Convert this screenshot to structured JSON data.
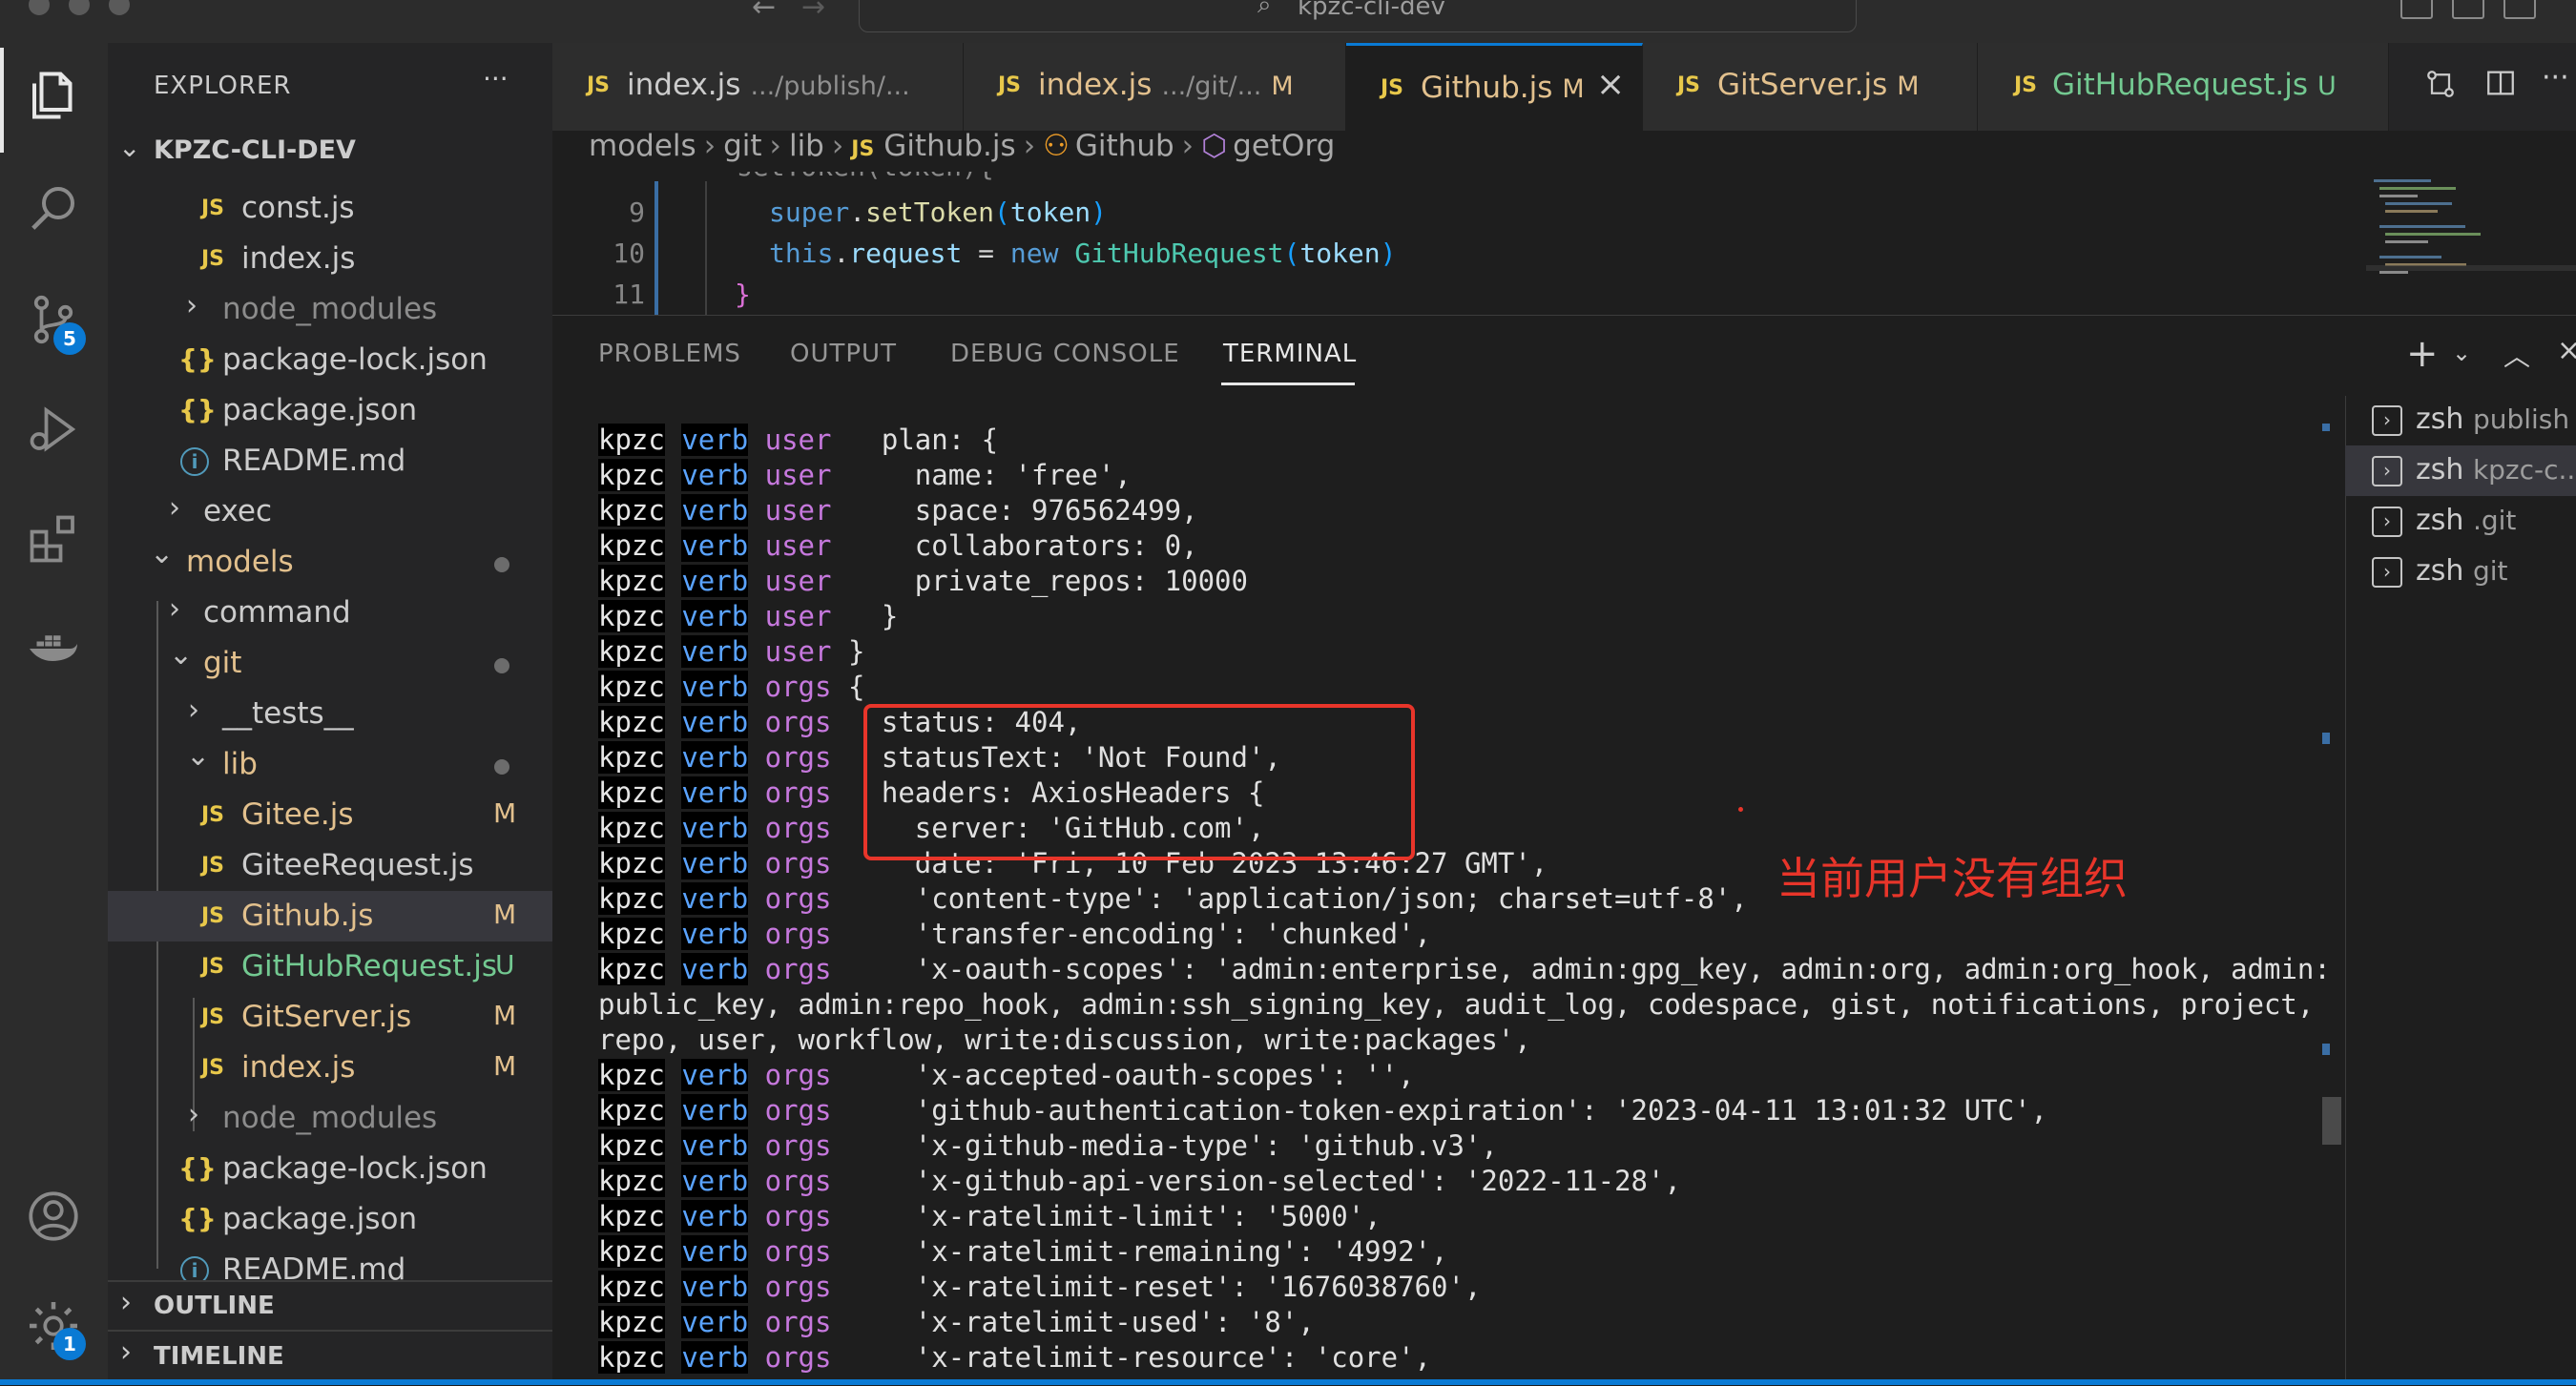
{
  "window": {
    "title": "kpzc-cli-dev"
  },
  "activity_bar": {
    "items": [
      {
        "icon": "files-icon"
      },
      {
        "icon": "search-icon"
      },
      {
        "icon": "source-control-icon",
        "badge": "5"
      },
      {
        "icon": "run-debug-icon"
      },
      {
        "icon": "extensions-icon"
      },
      {
        "icon": "docker-icon"
      }
    ],
    "bottom": [
      {
        "icon": "account-icon"
      },
      {
        "icon": "settings-gear-icon",
        "badge": "1"
      }
    ]
  },
  "sidebar": {
    "title": "EXPLORER",
    "more": "···",
    "root": "KPZC-CLI-DEV",
    "tree": [
      {
        "label": "const.js",
        "type": "js"
      },
      {
        "label": "index.js",
        "type": "js"
      },
      {
        "label": "node_modules",
        "type": "folder"
      },
      {
        "label": "package-lock.json",
        "type": "json"
      },
      {
        "label": "package.json",
        "type": "json"
      },
      {
        "label": "README.md",
        "type": "info"
      },
      {
        "label": "exec",
        "type": "folder"
      },
      {
        "label": "models",
        "type": "folder-open"
      },
      {
        "label": "command",
        "type": "folder"
      },
      {
        "label": "git",
        "type": "folder-open"
      },
      {
        "label": "__tests__",
        "type": "folder"
      },
      {
        "label": "lib",
        "type": "folder-open"
      },
      {
        "label": "Gitee.js",
        "type": "js",
        "status": "M"
      },
      {
        "label": "GiteeRequest.js",
        "type": "js"
      },
      {
        "label": "Github.js",
        "type": "js",
        "status": "M"
      },
      {
        "label": "GitHubRequest.js",
        "type": "js",
        "status": "U"
      },
      {
        "label": "GitServer.js",
        "type": "js",
        "status": "M"
      },
      {
        "label": "index.js",
        "type": "js",
        "status": "M"
      },
      {
        "label": "node_modules",
        "type": "folder"
      },
      {
        "label": "package-lock.json",
        "type": "json"
      },
      {
        "label": "package.json",
        "type": "json"
      },
      {
        "label": "README.md",
        "type": "info"
      }
    ],
    "outline": "OUTLINE",
    "timeline": "TIMELINE"
  },
  "tabs": [
    {
      "file": "index.js",
      "desc": ".../publish/...",
      "status": ""
    },
    {
      "file": "index.js",
      "desc": ".../git/...",
      "status": "M"
    },
    {
      "file": "Github.js",
      "desc": "",
      "status": "M",
      "close": "×"
    },
    {
      "file": "GitServer.js",
      "desc": "",
      "status": "M"
    },
    {
      "file": "GitHubRequest.js",
      "desc": "",
      "status": "U"
    }
  ],
  "breadcrumb": {
    "items": [
      "models",
      "git",
      "lib",
      "Github.js",
      "Github",
      "getOrg"
    ]
  },
  "code": {
    "lines": [
      {
        "num": "9"
      },
      {
        "num": "10"
      },
      {
        "num": "11"
      }
    ],
    "line8_partial": "setToken(token){",
    "line9": {
      "a": "super",
      "b": ".",
      "c": "setToken",
      "d": "(",
      "e": "token",
      "f": ")"
    },
    "line10": {
      "a": "this",
      "b": ".",
      "c": "request",
      "d": " = ",
      "e": "new",
      "f": " ",
      "g": "GitHubRequest",
      "h": "(",
      "i": "token",
      "j": ")"
    },
    "line11": "}"
  },
  "panel": {
    "tabs": [
      "PROBLEMS",
      "OUTPUT",
      "DEBUG CONSOLE",
      "TERMINAL"
    ],
    "active_tab": "TERMINAL"
  },
  "terminal": {
    "lines": [
      {
        "p": "kpzc",
        "v": "verb",
        "t": "user",
        "m": "  plan: {"
      },
      {
        "p": "kpzc",
        "v": "verb",
        "t": "user",
        "m": "    name: 'free',"
      },
      {
        "p": "kpzc",
        "v": "verb",
        "t": "user",
        "m": "    space: 976562499,"
      },
      {
        "p": "kpzc",
        "v": "verb",
        "t": "user",
        "m": "    collaborators: 0,"
      },
      {
        "p": "kpzc",
        "v": "verb",
        "t": "user",
        "m": "    private_repos: 10000"
      },
      {
        "p": "kpzc",
        "v": "verb",
        "t": "user",
        "m": "  }"
      },
      {
        "p": "kpzc",
        "v": "verb",
        "t": "user",
        "m": "}"
      },
      {
        "p": "kpzc",
        "v": "verb",
        "t": "orgs",
        "m": "{"
      },
      {
        "p": "kpzc",
        "v": "verb",
        "t": "orgs",
        "m": "  status: 404,"
      },
      {
        "p": "kpzc",
        "v": "verb",
        "t": "orgs",
        "m": "  statusText: 'Not Found',"
      },
      {
        "p": "kpzc",
        "v": "verb",
        "t": "orgs",
        "m": "  headers: AxiosHeaders {"
      },
      {
        "p": "kpzc",
        "v": "verb",
        "t": "orgs",
        "m": "    server: 'GitHub.com',"
      },
      {
        "p": "kpzc",
        "v": "verb",
        "t": "orgs",
        "m": "    date: 'Fri, 10 Feb 2023 13:46:27 GMT',"
      },
      {
        "p": "kpzc",
        "v": "verb",
        "t": "orgs",
        "m": "    'content-type': 'application/json; charset=utf-8',"
      },
      {
        "p": "kpzc",
        "v": "verb",
        "t": "orgs",
        "m": "    'transfer-encoding': 'chunked',"
      },
      {
        "p": "kpzc",
        "v": "verb",
        "t": "orgs",
        "m": "    'x-oauth-scopes': 'admin:enterprise, admin:gpg_key, admin:org, admin:org_hook, admin:"
      },
      {
        "p": "",
        "v": "",
        "t": "",
        "m": "public_key, admin:repo_hook, admin:ssh_signing_key, audit_log, codespace, gist, notifications, project,"
      },
      {
        "p": "",
        "v": "",
        "t": "",
        "m": "repo, user, workflow, write:discussion, write:packages',"
      },
      {
        "p": "kpzc",
        "v": "verb",
        "t": "orgs",
        "m": "    'x-accepted-oauth-scopes': '',"
      },
      {
        "p": "kpzc",
        "v": "verb",
        "t": "orgs",
        "m": "    'github-authentication-token-expiration': '2023-04-11 13:01:32 UTC',"
      },
      {
        "p": "kpzc",
        "v": "verb",
        "t": "orgs",
        "m": "    'x-github-media-type': 'github.v3',"
      },
      {
        "p": "kpzc",
        "v": "verb",
        "t": "orgs",
        "m": "    'x-github-api-version-selected': '2022-11-28',"
      },
      {
        "p": "kpzc",
        "v": "verb",
        "t": "orgs",
        "m": "    'x-ratelimit-limit': '5000',"
      },
      {
        "p": "kpzc",
        "v": "verb",
        "t": "orgs",
        "m": "    'x-ratelimit-remaining': '4992',"
      },
      {
        "p": "kpzc",
        "v": "verb",
        "t": "orgs",
        "m": "    'x-ratelimit-reset': '1676038760',"
      },
      {
        "p": "kpzc",
        "v": "verb",
        "t": "orgs",
        "m": "    'x-ratelimit-used': '8',"
      },
      {
        "p": "kpzc",
        "v": "verb",
        "t": "orgs",
        "m": "    'x-ratelimit-resource': 'core',"
      }
    ],
    "sessions": [
      {
        "name": "zsh",
        "title": "publish"
      },
      {
        "name": "zsh",
        "title": "kpzc-c..."
      },
      {
        "name": "zsh",
        "title": ".git"
      },
      {
        "name": "zsh",
        "title": "git"
      }
    ]
  },
  "annotation": {
    "text": "当前用户没有组织",
    "color": "#e8352a"
  },
  "colors": {
    "accent": "#0a7ad4",
    "modified": "#e2c08d",
    "untracked": "#73c991",
    "js_icon": "#e8c84a"
  }
}
